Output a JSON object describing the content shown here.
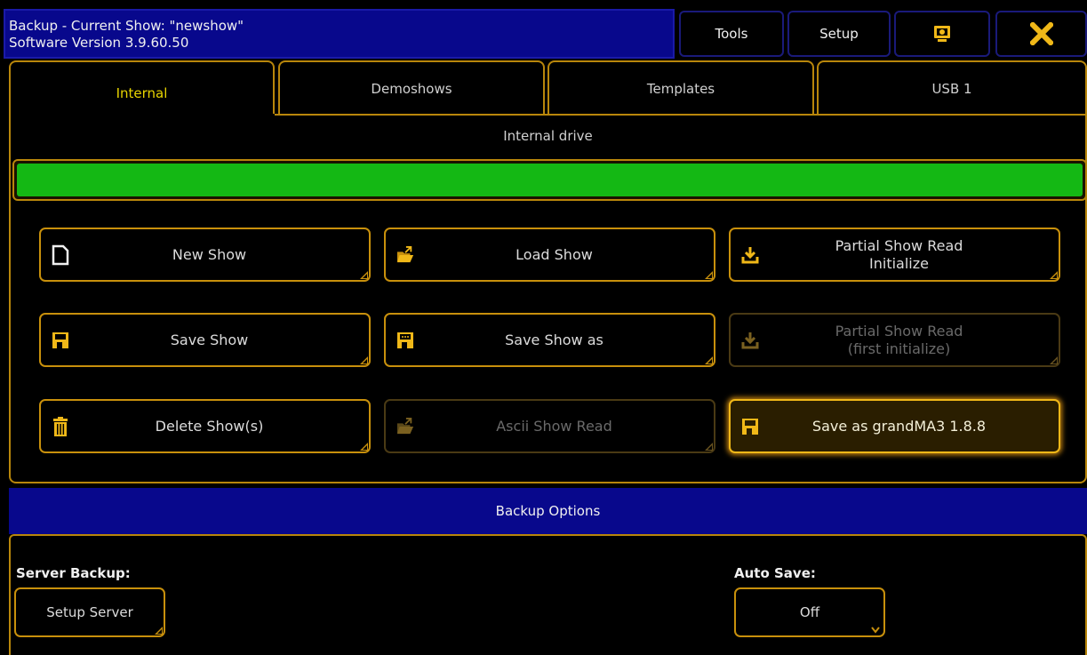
{
  "window": {
    "title_line1": "Backup - Current Show: \"newshow\"",
    "title_line2": "Software Version 3.9.60.50"
  },
  "toolbar": {
    "tools_label": "Tools",
    "setup_label": "Setup",
    "screen_icon": "screen-icon",
    "close_icon": "close-icon"
  },
  "tabs": [
    {
      "label": "Internal",
      "active": true
    },
    {
      "label": "Demoshows",
      "active": false
    },
    {
      "label": "Templates",
      "active": false
    },
    {
      "label": "USB 1",
      "active": false
    }
  ],
  "drive": {
    "label": "Internal drive",
    "fill_fraction": 1.0,
    "fill_color": "#14b814"
  },
  "buttons": {
    "new_show": {
      "label": "New Show",
      "icon": "file-icon"
    },
    "load_show": {
      "label": "Load Show",
      "icon": "folder-open-icon"
    },
    "partial_init": {
      "label_line1": "Partial Show Read",
      "label_line2": "Initialize",
      "icon": "download-icon"
    },
    "save_show": {
      "label": "Save Show",
      "icon": "floppy-icon"
    },
    "save_show_as": {
      "label": "Save Show as",
      "icon": "floppy-dots-icon"
    },
    "partial_first": {
      "label_line1": "Partial Show Read",
      "label_line2": "(first initialize)",
      "icon": "download-icon",
      "disabled": true
    },
    "delete_show": {
      "label": "Delete Show(s)",
      "icon": "trash-icon"
    },
    "ascii_read": {
      "label": "Ascii Show Read",
      "icon": "folder-open-icon",
      "disabled": true
    },
    "save_grandma3": {
      "label": "Save as grandMA3 1.8.8",
      "icon": "floppy-icon",
      "highlighted": true
    }
  },
  "backup_options": {
    "header": "Backup Options",
    "server_backup_label": "Server Backup:",
    "setup_server_label": "Setup Server",
    "auto_save_label": "Auto Save:",
    "auto_save_value": "Off"
  },
  "colors": {
    "accent_gold": "#c8900c",
    "title_blue": "#08088c",
    "active_tab_text": "#e8d400",
    "close_x": "#f0b818"
  }
}
